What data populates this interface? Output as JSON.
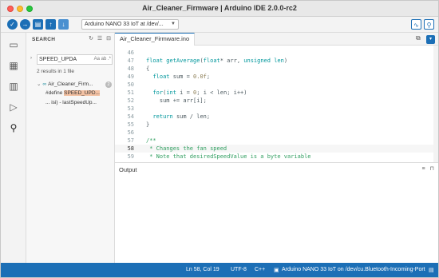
{
  "window": {
    "title": "Air_Cleaner_Firmware | Arduino IDE 2.0.0-rc2"
  },
  "toolbar": {
    "verify_icon": "checkmark-icon",
    "upload_icon": "arrow-right-icon",
    "debug_icon": "debug-icon",
    "new_icon": "arrow-up-icon",
    "open_icon": "arrow-down-icon",
    "board_value": "Arduino NANO 33 IoT at /dev/...",
    "serial_plotter_icon": "pulse-icon",
    "serial_monitor_icon": "search-icon"
  },
  "activity": {
    "items": [
      "folder-icon",
      "board-icon",
      "library-icon",
      "debug-icon",
      "search-icon"
    ]
  },
  "search": {
    "title": "SEARCH",
    "query": "SPEED_UPDA",
    "flags": "Aa  ab  .*",
    "summary": "2 results in 1 file",
    "file_name": "Air_Cleaner_Firm...",
    "file_count": "2",
    "match1_prefix": "#define ",
    "match1_hit": "SPEED_UPD...",
    "match2_text": "... isi) - lastSpeedUp..."
  },
  "editor": {
    "tab_label": "Air_Cleaner_Firmware.ino",
    "lines": [
      {
        "n": "46",
        "html": ""
      },
      {
        "n": "47",
        "html": "<span class=\"ty\">float</span> <span class=\"kw\">getAverage</span>(<span class=\"ty\">float</span>* arr, <span class=\"ty\">unsigned</span> <span class=\"ty\">len</span>)"
      },
      {
        "n": "48",
        "html": "{"
      },
      {
        "n": "49",
        "html": "  <span class=\"ty\">float</span> sum = <span class=\"num\">0.0f</span>;"
      },
      {
        "n": "50",
        "html": ""
      },
      {
        "n": "51",
        "html": "  <span class=\"kw\">for</span>(<span class=\"ty\">int</span> i = <span class=\"num\">0</span>; i &lt; len; i++)"
      },
      {
        "n": "52",
        "html": "    sum += arr[i];"
      },
      {
        "n": "53",
        "html": ""
      },
      {
        "n": "54",
        "html": "  <span class=\"kw\">return</span> sum / len;"
      },
      {
        "n": "55",
        "html": "}"
      },
      {
        "n": "56",
        "html": ""
      },
      {
        "n": "57",
        "html": "<span class=\"cm\">/**</span>"
      },
      {
        "n": "58",
        "html": "<span class=\"cm\"> * Changes the fan speed</span>"
      },
      {
        "n": "59",
        "html": "<span class=\"cm\"> * Note that desiredSpeedValue is a byte variable</span>"
      }
    ]
  },
  "output": {
    "title": "Output"
  },
  "status": {
    "position": "Ln 58, Col 19",
    "encoding": "UTF-8",
    "language": "C++",
    "board": "Arduino NANO 33 IoT on /dev/cu.Bluetooth-Incoming-Port"
  },
  "colors": {
    "accent": "#1c6fb6",
    "keyword": "#00979c",
    "comment": "#2f9e5f",
    "highlight": "#f3c1a3"
  }
}
